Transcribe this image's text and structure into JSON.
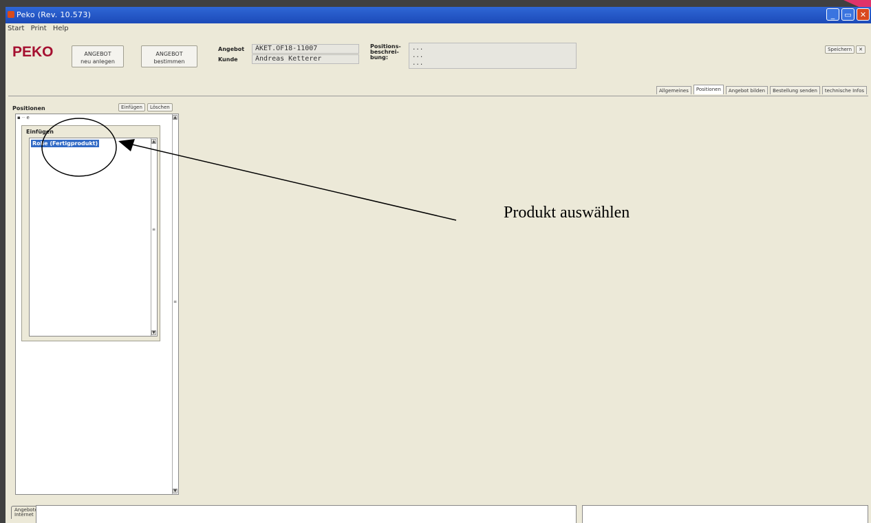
{
  "window": {
    "title": "Peko (Rev. 10.573)",
    "controls": {
      "minimize": "_",
      "maximize": "▭",
      "close": "✕"
    }
  },
  "menu": [
    "Start",
    "Print",
    "Help"
  ],
  "header": {
    "logo": "PEKO",
    "btn_new": {
      "line1": "ANGEBOT",
      "line2": "neu anlegen"
    },
    "btn_finish": {
      "line1": "ANGEBOT",
      "line2": "bestimmen"
    },
    "angebot_label": "Angebot",
    "angebot_value": "AKET.OF18-11007",
    "kunde_label": "Kunde",
    "kunde_value": "Andreas Ketterer",
    "posdesc_label": {
      "line1": "Positions-",
      "line2": "beschrei-",
      "line3": "bung:"
    },
    "posdesc_value": {
      "line1": "...",
      "line2": "...",
      "line3": "..."
    },
    "save_label": "Speichern",
    "close_label": "✕"
  },
  "tabs": [
    {
      "label": "Allgemeines",
      "active": false
    },
    {
      "label": "Positionen",
      "active": true
    },
    {
      "label": "Angebot bilden",
      "active": false
    },
    {
      "label": "Bestellung senden",
      "active": false
    },
    {
      "label": "technische Infos",
      "active": false
    }
  ],
  "positions": {
    "heading": "Positionen",
    "insert_label": "Einfügen",
    "delete_label": "Löschen",
    "tree_node": "e",
    "popup_title": "Einfügen",
    "selected_item": "Rolle (Fertigprodukt)"
  },
  "annotation": {
    "text": "Produkt auswählen"
  },
  "bottom": {
    "tab_line1": "Angebote",
    "tab_line2": "Internet"
  },
  "colors": {
    "titlebar": "#1c4ab8",
    "logo": "#a51030",
    "selection": "#316ac5",
    "annotation": "#000000"
  }
}
